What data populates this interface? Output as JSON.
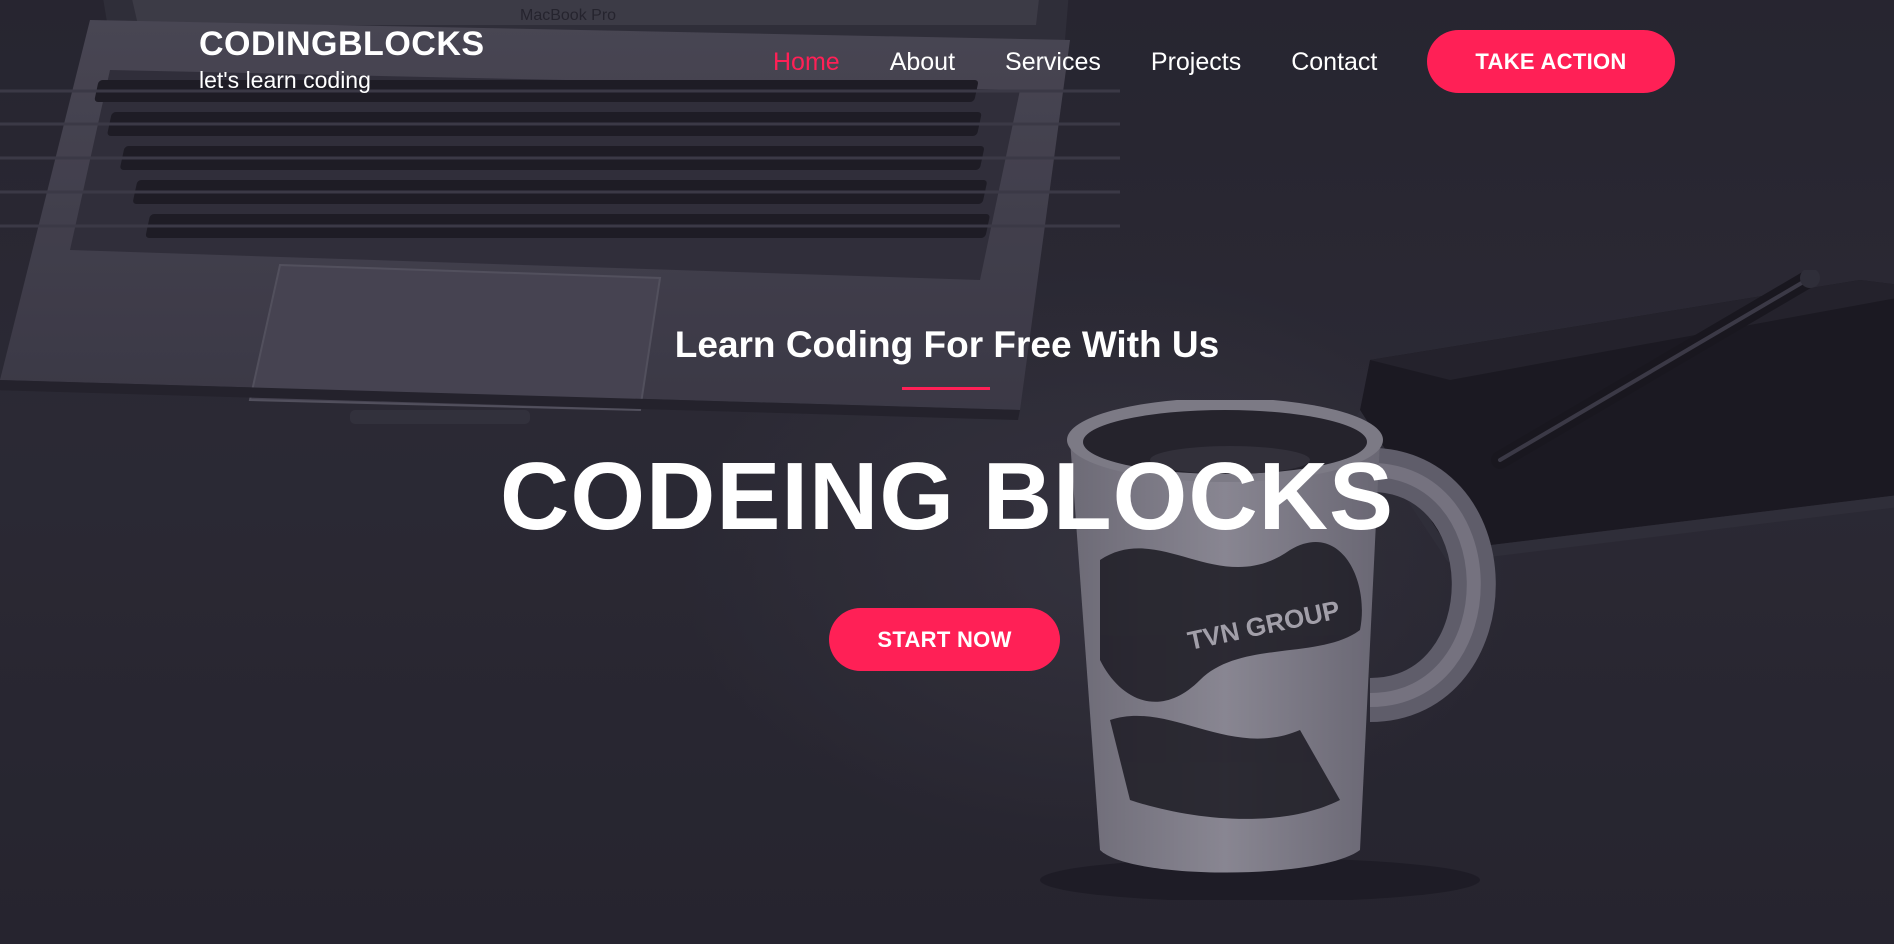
{
  "header": {
    "brand_name": "CODINGBLOCKS",
    "brand_tagline": "let's learn coding",
    "nav": [
      {
        "label": "Home",
        "active": true
      },
      {
        "label": "About",
        "active": false
      },
      {
        "label": "Services",
        "active": false
      },
      {
        "label": "Projects",
        "active": false
      },
      {
        "label": "Contact",
        "active": false
      }
    ],
    "cta_label": "TAKE ACTION"
  },
  "hero": {
    "subtitle": "Learn Coding For Free With Us",
    "title": "CODEING BLOCKS",
    "cta_label": "START NOW",
    "laptop_label": "MacBook Pro",
    "mug_print": "TVN GROUP"
  },
  "colors": {
    "accent": "#ff2056",
    "text": "#ffffff",
    "background": "#2e2d38"
  }
}
